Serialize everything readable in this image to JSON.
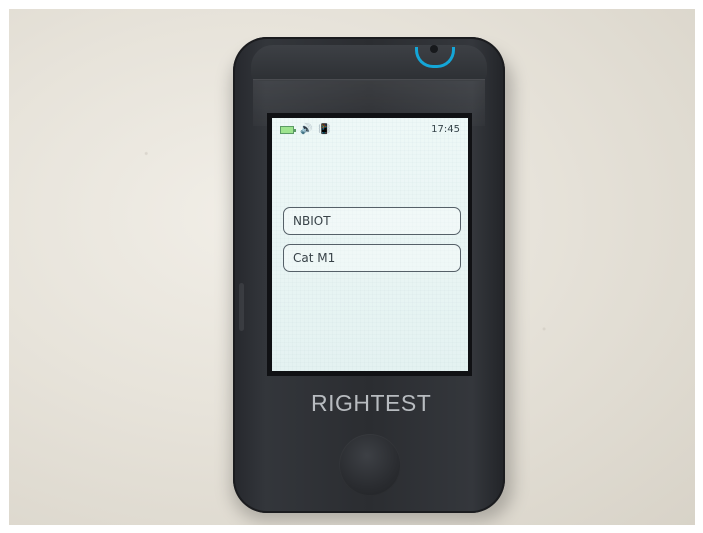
{
  "device": {
    "brand": "RIGHTEST"
  },
  "status_bar": {
    "battery_icon": "battery-icon",
    "sound_icon": "sound-icon",
    "vibrate_icon": "vibrate-icon",
    "time": "17:45"
  },
  "menu": {
    "items": [
      {
        "label": "NBIOT"
      },
      {
        "label": "Cat M1"
      }
    ]
  },
  "colors": {
    "led_blue": "#14a6d7",
    "battery_green": "#9ee48f",
    "screen_background": "#e4f2f1"
  }
}
